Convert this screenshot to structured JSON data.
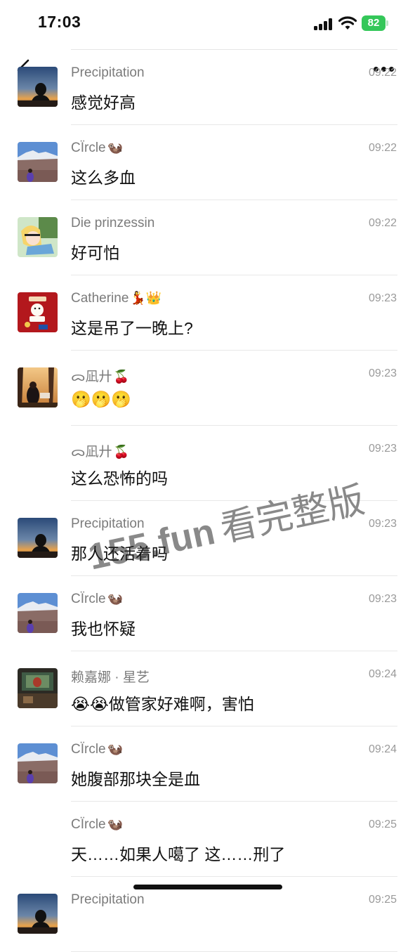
{
  "status_bar": {
    "time": "17:03",
    "battery": "82"
  },
  "watermark": {
    "site": "155.fun",
    "text": "看完整版"
  },
  "messages": [
    {
      "sender": "Precipitation",
      "sender_emoji": "",
      "time": "09:22",
      "text": "感觉好高",
      "avatar": "sunset-silhouette"
    },
    {
      "sender": "CÏrcle",
      "sender_emoji": "🦦",
      "time": "09:22",
      "text": "这么多血",
      "avatar": "mountain-landscape"
    },
    {
      "sender": "Die prinzessin",
      "sender_emoji": "",
      "time": "09:22",
      "text": "好可怕",
      "avatar": "cartoon-alice"
    },
    {
      "sender": "Catherine",
      "sender_emoji": "💃👑",
      "time": "09:23",
      "text": "这是吊了一晚上?",
      "avatar": "red-poster"
    },
    {
      "sender": "ᯅ凪廾",
      "sender_emoji": "🍒",
      "time": "09:23",
      "text": "🫢🫢🫢",
      "avatar": "park-photo"
    },
    {
      "sender": "ᯅ凪廾",
      "sender_emoji": "🍒",
      "time": "09:23",
      "text": "这么恐怖的吗",
      "avatar": ""
    },
    {
      "sender": "Precipitation",
      "sender_emoji": "",
      "time": "09:23",
      "text": "那人还活着吗",
      "avatar": "sunset-silhouette"
    },
    {
      "sender": "CÏrcle",
      "sender_emoji": "🦦",
      "time": "09:23",
      "text": "我也怀疑",
      "avatar": "mountain-landscape"
    },
    {
      "sender": "赖嘉娜 · 星艺",
      "sender_emoji": "",
      "time": "09:24",
      "text": "😭😭做管家好难啊，害怕",
      "avatar": "dark-room"
    },
    {
      "sender": "CÏrcle",
      "sender_emoji": "🦦",
      "time": "09:24",
      "text": "她腹部那块全是血",
      "avatar": "mountain-landscape"
    },
    {
      "sender": "CÏrcle",
      "sender_emoji": "🦦",
      "time": "09:25",
      "text": "天……如果人噶了 这……刑了",
      "avatar": ""
    },
    {
      "sender": "Precipitation",
      "sender_emoji": "",
      "time": "09:25",
      "text": "",
      "avatar": "sunset-silhouette"
    }
  ],
  "icons": {
    "back": "chevron-left-icon",
    "more": "more-dots-icon",
    "wifi": "wifi-icon",
    "signal": "signal-icon"
  },
  "colors": {
    "battery": "#34c759",
    "sender": "#7b7b7b",
    "time": "#9a9a9a"
  }
}
